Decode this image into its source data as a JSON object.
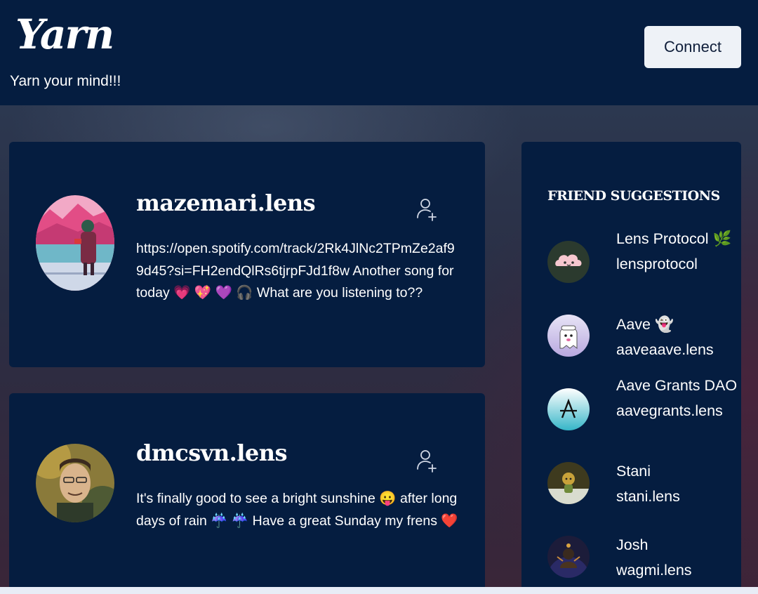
{
  "header": {
    "logo": "Yarn",
    "tagline": "Yarn your mind!!!",
    "connect_label": "Connect"
  },
  "posts": [
    {
      "handle": "mazemari.lens",
      "text": "https://open.spotify.com/track/2Rk4JlNc2TPmZe2af99d45?si=FH2endQlRs6tjrpFJd1f8w Another song for today 💗 💖 💜 🎧 What are you listening to??",
      "follow_icon": "add-user-icon"
    },
    {
      "handle": "dmcsvn.lens",
      "text": "It's finally good to see a bright sunshine 😛 after long days of rain ☔ ☔ Have a great Sunday my frens ❤️",
      "follow_icon": "add-user-icon"
    }
  ],
  "suggestions": {
    "title": "FRIEND SUGGESTIONS",
    "items": [
      {
        "name": "Lens Protocol 🌿",
        "handle": "lensprotocol"
      },
      {
        "name": "Aave 👻",
        "handle": "aaveaave.lens"
      },
      {
        "name": "Aave Grants DAO",
        "handle": "aavegrants.lens"
      },
      {
        "name": "Stani",
        "handle": "stani.lens"
      },
      {
        "name": "Josh",
        "handle": "wagmi.lens"
      }
    ]
  },
  "colors": {
    "header_bg": "#051d40",
    "card_bg": "#051d40",
    "button_bg": "#eef2f7"
  }
}
